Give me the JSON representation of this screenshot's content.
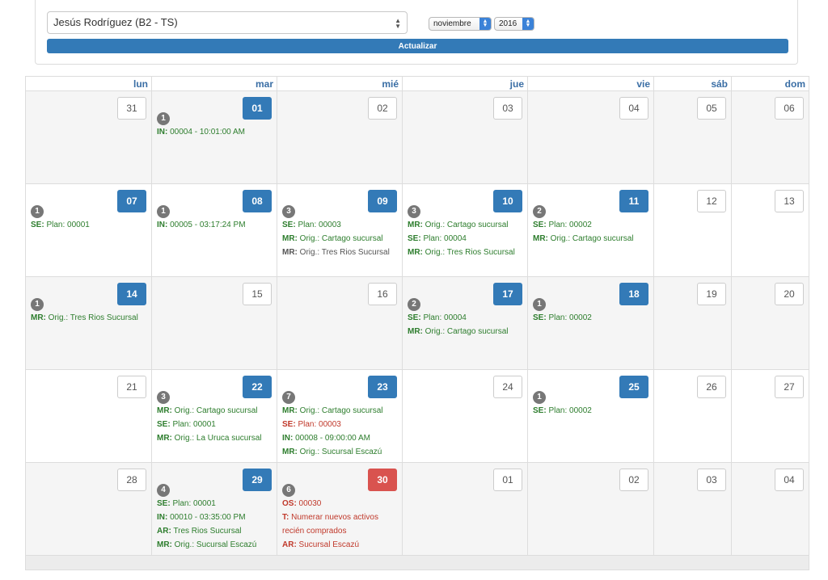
{
  "filters": {
    "user_select": "Jesús Rodríguez (B2 - TS)",
    "month_select": "noviembre",
    "year_select": "2016",
    "update_label": "Actualizar"
  },
  "weekdays": [
    "lun",
    "mar",
    "mié",
    "jue",
    "vie",
    "sáb",
    "dom"
  ],
  "colors": {
    "primary": "#337ab7",
    "danger": "#d9534f",
    "event_green": "#2d7d2d",
    "event_red": "#c0392b",
    "badge": "#777777"
  },
  "weeks": [
    {
      "days": [
        {
          "num": "31",
          "style": "plain",
          "shade": true
        },
        {
          "num": "01",
          "style": "blue",
          "shade": true,
          "badge": "1",
          "events": [
            {
              "k": "IN:",
              "v": " 00004 - 10:01:00 AM",
              "c": "green"
            }
          ]
        },
        {
          "num": "02",
          "style": "plain",
          "shade": true
        },
        {
          "num": "03",
          "style": "plain",
          "shade": true
        },
        {
          "num": "04",
          "style": "plain",
          "shade": true
        },
        {
          "num": "05",
          "style": "plain",
          "shade": true
        },
        {
          "num": "06",
          "style": "plain",
          "shade": true
        }
      ]
    },
    {
      "days": [
        {
          "num": "07",
          "style": "blue",
          "shade": false,
          "badge": "1",
          "events": [
            {
              "k": "SE:",
              "v": " Plan: 00001",
              "c": "green"
            }
          ]
        },
        {
          "num": "08",
          "style": "blue",
          "shade": false,
          "badge": "1",
          "events": [
            {
              "k": "IN:",
              "v": " 00005 - 03:17:24 PM",
              "c": "green"
            }
          ]
        },
        {
          "num": "09",
          "style": "blue",
          "shade": false,
          "badge": "3",
          "events": [
            {
              "k": "SE:",
              "v": " Plan: 00003",
              "c": "green"
            },
            {
              "k": "MR:",
              "v": " Orig.: Cartago sucursal",
              "c": "green"
            },
            {
              "k": "MR:",
              "v": " Orig.: Tres Rios Sucursal",
              "c": "gray"
            }
          ]
        },
        {
          "num": "10",
          "style": "blue",
          "shade": false,
          "badge": "3",
          "events": [
            {
              "k": "MR:",
              "v": " Orig.: Cartago sucursal",
              "c": "green"
            },
            {
              "k": "SE:",
              "v": " Plan: 00004",
              "c": "green"
            },
            {
              "k": "MR:",
              "v": " Orig.: Tres Rios Sucursal",
              "c": "green"
            }
          ]
        },
        {
          "num": "11",
          "style": "blue",
          "shade": false,
          "badge": "2",
          "events": [
            {
              "k": "SE:",
              "v": " Plan: 00002",
              "c": "green"
            },
            {
              "k": "MR:",
              "v": " Orig.: Cartago sucursal",
              "c": "green"
            }
          ]
        },
        {
          "num": "12",
          "style": "plain",
          "shade": false
        },
        {
          "num": "13",
          "style": "plain",
          "shade": false
        }
      ]
    },
    {
      "days": [
        {
          "num": "14",
          "style": "blue",
          "shade": true,
          "badge": "1",
          "events": [
            {
              "k": "MR:",
              "v": " Orig.: Tres Rios Sucursal",
              "c": "green"
            }
          ]
        },
        {
          "num": "15",
          "style": "plain",
          "shade": true
        },
        {
          "num": "16",
          "style": "plain",
          "shade": true
        },
        {
          "num": "17",
          "style": "blue",
          "shade": true,
          "badge": "2",
          "events": [
            {
              "k": "SE:",
              "v": " Plan: 00004",
              "c": "green"
            },
            {
              "k": "MR:",
              "v": " Orig.: Cartago sucursal",
              "c": "green"
            }
          ]
        },
        {
          "num": "18",
          "style": "blue",
          "shade": true,
          "badge": "1",
          "events": [
            {
              "k": "SE:",
              "v": " Plan: 00002",
              "c": "green"
            }
          ]
        },
        {
          "num": "19",
          "style": "plain",
          "shade": true
        },
        {
          "num": "20",
          "style": "plain",
          "shade": true
        }
      ]
    },
    {
      "days": [
        {
          "num": "21",
          "style": "plain",
          "shade": false
        },
        {
          "num": "22",
          "style": "blue",
          "shade": false,
          "badge": "3",
          "events": [
            {
              "k": "MR:",
              "v": " Orig.: Cartago sucursal",
              "c": "green"
            },
            {
              "k": "SE:",
              "v": " Plan: 00001",
              "c": "green"
            },
            {
              "k": "MR:",
              "v": " Orig.: La Uruca sucursal",
              "c": "green"
            }
          ]
        },
        {
          "num": "23",
          "style": "blue",
          "shade": false,
          "badge": "7",
          "events": [
            {
              "k": "MR:",
              "v": " Orig.: Cartago sucursal",
              "c": "green"
            },
            {
              "k": "SE:",
              "v": " Plan: 00003",
              "c": "red"
            },
            {
              "k": "IN:",
              "v": " 00008 - 09:00:00 AM",
              "c": "green"
            },
            {
              "k": "MR:",
              "v": " Orig.: Sucursal Escazú",
              "c": "green"
            }
          ]
        },
        {
          "num": "24",
          "style": "plain",
          "shade": false
        },
        {
          "num": "25",
          "style": "blue",
          "shade": false,
          "badge": "1",
          "events": [
            {
              "k": "SE:",
              "v": " Plan: 00002",
              "c": "green"
            }
          ]
        },
        {
          "num": "26",
          "style": "plain",
          "shade": false
        },
        {
          "num": "27",
          "style": "plain",
          "shade": false
        }
      ]
    },
    {
      "days": [
        {
          "num": "28",
          "style": "plain",
          "shade": true
        },
        {
          "num": "29",
          "style": "blue",
          "shade": true,
          "badge": "4",
          "events": [
            {
              "k": "SE:",
              "v": " Plan: 00001",
              "c": "green"
            },
            {
              "k": "IN:",
              "v": " 00010 - 03:35:00 PM",
              "c": "green"
            },
            {
              "k": "AR:",
              "v": " Tres Rios Sucursal",
              "c": "green"
            },
            {
              "k": "MR:",
              "v": " Orig.: Sucursal Escazú",
              "c": "green"
            }
          ]
        },
        {
          "num": "30",
          "style": "red",
          "shade": true,
          "badge": "6",
          "events": [
            {
              "k": "OS:",
              "v": " 00030",
              "c": "red"
            },
            {
              "k": "T:",
              "v": " Numerar nuevos activos recién comprados",
              "c": "red",
              "wrap": true
            },
            {
              "k": "AR:",
              "v": " Sucursal Escazú",
              "c": "red"
            }
          ]
        },
        {
          "num": "01",
          "style": "plain",
          "shade": true
        },
        {
          "num": "02",
          "style": "plain",
          "shade": true
        },
        {
          "num": "03",
          "style": "plain",
          "shade": true
        },
        {
          "num": "04",
          "style": "plain",
          "shade": true
        }
      ]
    }
  ]
}
